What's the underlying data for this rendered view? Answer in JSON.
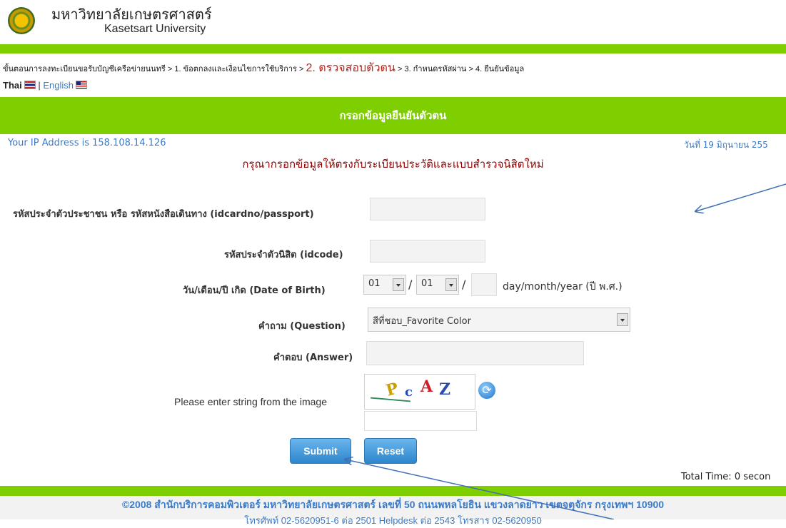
{
  "header": {
    "university_th": "มหาวิทยาลัยเกษตรศาสตร์",
    "university_en": "Kasetsart University"
  },
  "breadcrumb": {
    "prefix": "ขั้นตอนการลงทะเบียนขอรับบัญชีเครือข่ายนนทรี",
    "step1": "1. ข้อตกลงและเงื่อนไขการใช้บริการ",
    "step2": "2. ตรวจสอบตัวตน",
    "step3": "3. กำหนดรหัสผ่าน",
    "step4": "4. ยืนยันข้อมูล",
    "separator": ">"
  },
  "language": {
    "thai": "Thai",
    "english": "English",
    "divider": "|"
  },
  "page": {
    "title": "กรอกข้อมูลยืนยันตัวตน",
    "ip_text": "Your IP Address is 158.108.14.126",
    "date_text": "วันที่ 19 มิถุนายน 255",
    "instruction": "กรุณากรอกข้อมูลให้ตรงกับระเบียนประวัติและแบบสำรวจนิสิตใหม่"
  },
  "form": {
    "idcard_label": "รหัสประจำตัวประชาชน หรือ รหัสหนังสือเดินทาง (idcardno/passport)",
    "idcode_label": "รหัสประจำตัวนิสิต (idcode)",
    "dob_label": "วัน/เดือน/ปี เกิด (Date of Birth)",
    "dob_day": "01",
    "dob_month": "01",
    "dob_sep": "/",
    "dob_hint": "day/month/year (ปี พ.ศ.)",
    "question_label": "คำถาม (Question)",
    "question_value": "สีที่ชอบ_Favorite Color",
    "answer_label": "คำตอบ (Answer)",
    "captcha_label": "Please enter string from the image",
    "submit": "Submit",
    "reset": "Reset"
  },
  "captcha_chars": [
    "P",
    "c",
    "A",
    "Z"
  ],
  "total_time": "Total Time: 0 secon",
  "footer": {
    "line1": "©2008 สำนักบริการคอมพิวเตอร์ มหาวิทยาลัยเกษตรศาสตร์ เลขที่ 50 ถนนพหลโยธิน แขวงลาดยาว เขตจตุจักร กรุงเทพฯ 10900",
    "line2": "โทรศัพท์ 02-5620951-6 ต่อ 2501 Helpdesk ต่อ 2543 โทรสาร 02-5620950"
  },
  "colors": {
    "green_bar": "#7fcf00",
    "link_blue": "#3a7bc8",
    "instruction_red": "#8b0000",
    "annotation_arrow": "#3f6fb5"
  }
}
